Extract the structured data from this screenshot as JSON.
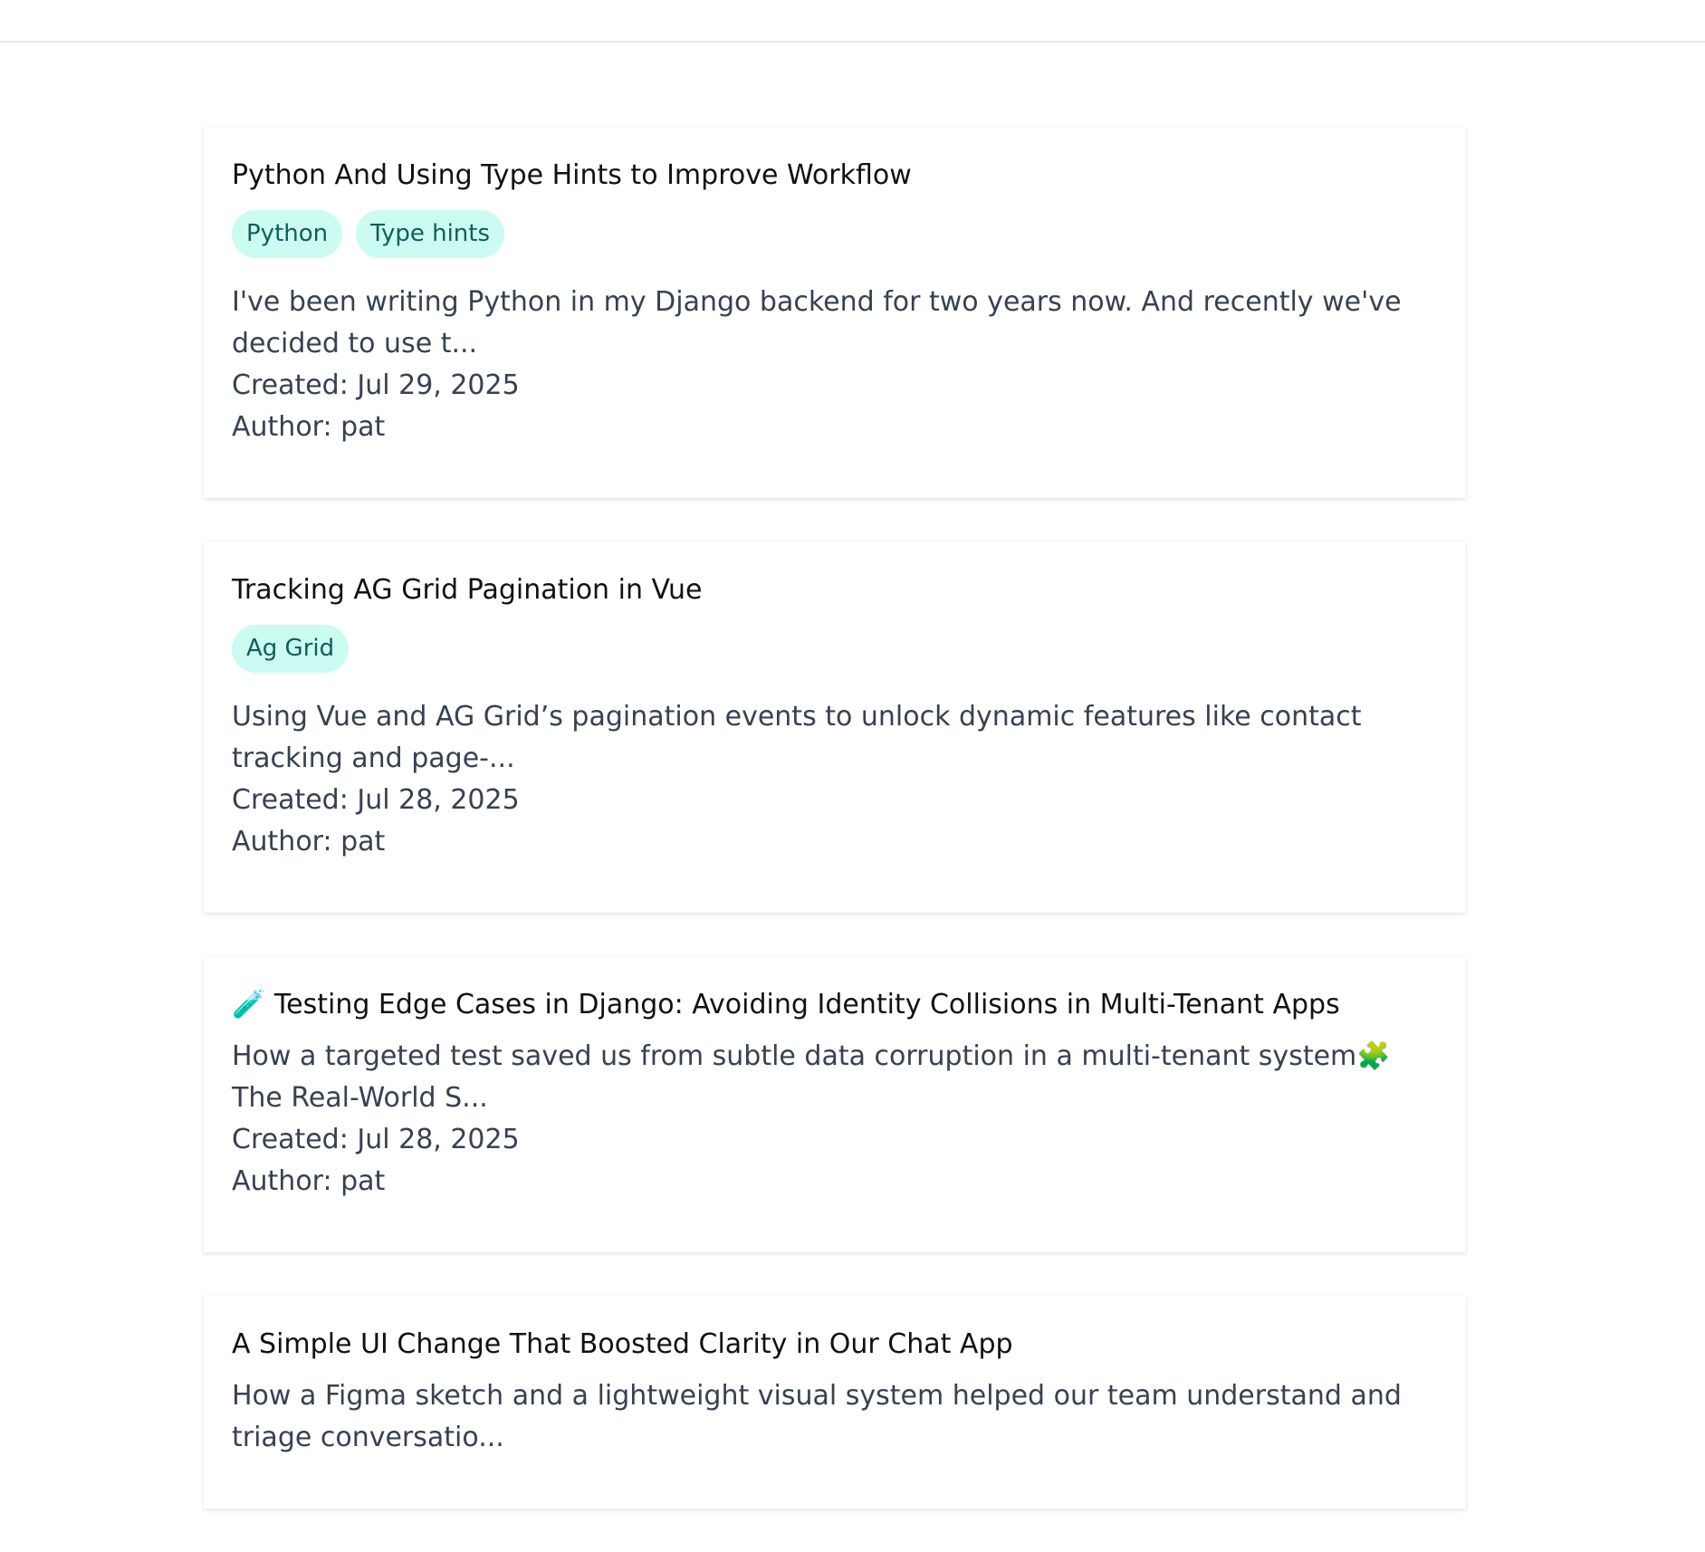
{
  "posts": [
    {
      "title": "Python And Using Type Hints to Improve Workflow",
      "tags": [
        "Python",
        "Type hints"
      ],
      "excerpt": "I've been writing Python in my Django backend for two years now. And recently we've decided to use t...",
      "created": "Created: Jul 29, 2025",
      "author": "Author: pat"
    },
    {
      "title": "Tracking AG Grid Pagination in Vue",
      "tags": [
        "Ag Grid"
      ],
      "excerpt": "Using Vue and AG Grid’s pagination events to unlock dynamic features like contact tracking and page-...",
      "created": "Created: Jul 28, 2025",
      "author": "Author: pat"
    },
    {
      "title_emoji": "🧪",
      "title": "Testing Edge Cases in Django: Avoiding Identity Collisions in Multi-Tenant Apps",
      "tags": [],
      "excerpt_part1": "How a targeted test saved us from subtle data corruption in a multi-tenant system",
      "excerpt_emoji": "🧩",
      "excerpt_part2": " The Real-World S...",
      "created": "Created: Jul 28, 2025",
      "author": "Author: pat"
    },
    {
      "title": "A Simple UI Change That Boosted Clarity in Our Chat App",
      "tags": [],
      "excerpt": "How a Figma sketch and a lightweight visual system helped our team understand and triage conversatio..."
    }
  ]
}
